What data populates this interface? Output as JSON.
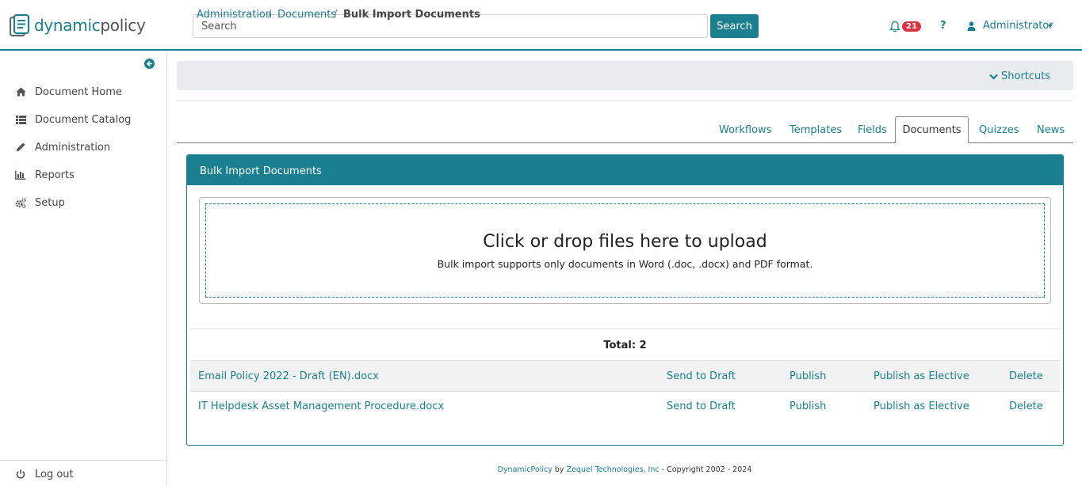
{
  "brand": {
    "name_part1": "dynamic",
    "name_part2": "policy",
    "color": "#1a7f8e"
  },
  "header": {
    "search_placeholder": "Search",
    "search_button": "Search",
    "notification_count": "21",
    "help_label": "?",
    "user_name": "Administrator"
  },
  "sidebar": {
    "items": [
      {
        "label": "Document Home",
        "icon": "home-icon"
      },
      {
        "label": "Document Catalog",
        "icon": "list-icon"
      },
      {
        "label": "Administration",
        "icon": "pencil-icon"
      },
      {
        "label": "Reports",
        "icon": "bar-chart-icon"
      },
      {
        "label": "Setup",
        "icon": "gears-icon"
      }
    ],
    "logout": "Log out"
  },
  "breadcrumb": {
    "items": [
      "Administration",
      "Documents",
      "Bulk Import Documents"
    ],
    "separator": "/"
  },
  "shortcuts_label": "Shortcuts",
  "tabs": [
    "Workflows",
    "Templates",
    "Fields",
    "Documents",
    "Quizzes",
    "News"
  ],
  "active_tab": "Documents",
  "panel": {
    "title": "Bulk Import Documents",
    "dropzone_title": "Click or drop files here to upload",
    "dropzone_subtitle": "Bulk import supports only documents in Word (.doc, .docx) and PDF format.",
    "total_label": "Total: 2",
    "actions": {
      "draft": "Send to Draft",
      "publish": "Publish",
      "elective": "Publish as Elective",
      "delete": "Delete"
    },
    "files": [
      {
        "name": "Email Policy 2022 - Draft (EN).docx"
      },
      {
        "name": "IT Helpdesk Asset Management Procedure.docx"
      }
    ]
  },
  "footer": {
    "product": "DynamicPolicy",
    "by": "by",
    "company": "Zequel Technologies, Inc",
    "copyright": "- Copyright 2002 - 2024"
  }
}
